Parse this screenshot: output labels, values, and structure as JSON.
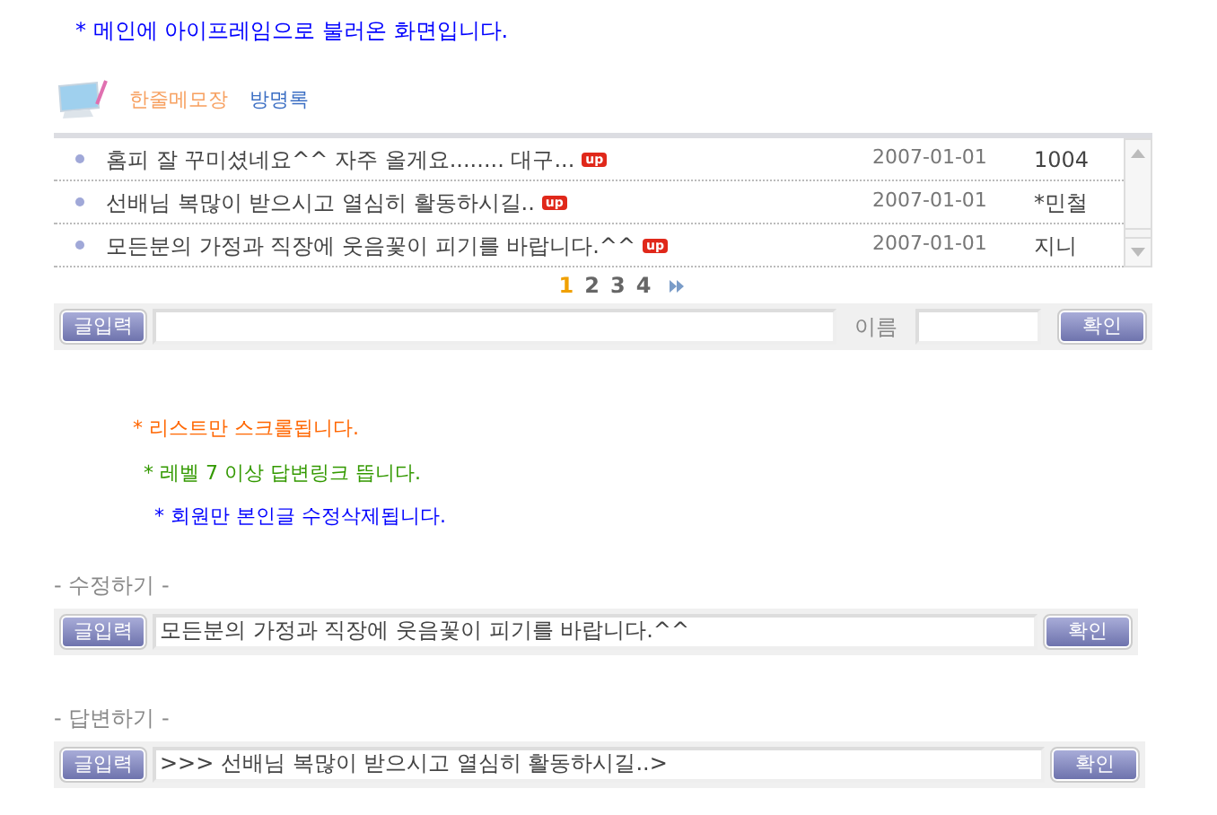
{
  "notice": "* 메인에 아이프레임으로 불러온 화면입니다.",
  "tabs": [
    {
      "label": "한줄메모장",
      "selected": true
    },
    {
      "label": "방명록",
      "selected": false
    }
  ],
  "memo_list": {
    "rows": [
      {
        "text": "홈피 잘 꾸미셨네요^^ 자주 올게요........ 대구...",
        "badge": "up",
        "date": "2007-01-01",
        "author": "1004"
      },
      {
        "text": "선배님 복많이 받으시고 열심히 활동하시길..",
        "badge": "up",
        "date": "2007-01-01",
        "author": "*민철"
      },
      {
        "text": "모든분의 가정과 직장에 웃음꽃이 피기를 바랍니다.^^",
        "badge": "up",
        "date": "2007-01-01",
        "author": "지니"
      }
    ]
  },
  "pagination": [
    {
      "label": "1",
      "selected": true
    },
    {
      "label": "2",
      "selected": false
    },
    {
      "label": "3",
      "selected": false
    },
    {
      "label": "4",
      "selected": false
    }
  ],
  "write_bar": {
    "button": "글입력",
    "name_label": "이름",
    "submit": "확인"
  },
  "notes": [
    {
      "text": "* 리스트만 스크롤됩니다.",
      "color": "#ff6600"
    },
    {
      "text": "* 레벨 7 이상 답변링크 뜹니다.",
      "color": "#339900"
    },
    {
      "text": "* 회원만 본인글 수정삭제됩니다.",
      "color": "#0000ff"
    }
  ],
  "edit": {
    "title": "- 수정하기 -",
    "button": "글입력",
    "value": "모든분의 가정과 직장에 웃음꽃이 피기를 바랍니다.^^",
    "submit": "확인"
  },
  "reply": {
    "title": "- 답변하기 -",
    "button": "글입력",
    "value": ">>> 선배님 복많이 받으시고 열심히 활동하시길..>",
    "submit": "확인"
  }
}
